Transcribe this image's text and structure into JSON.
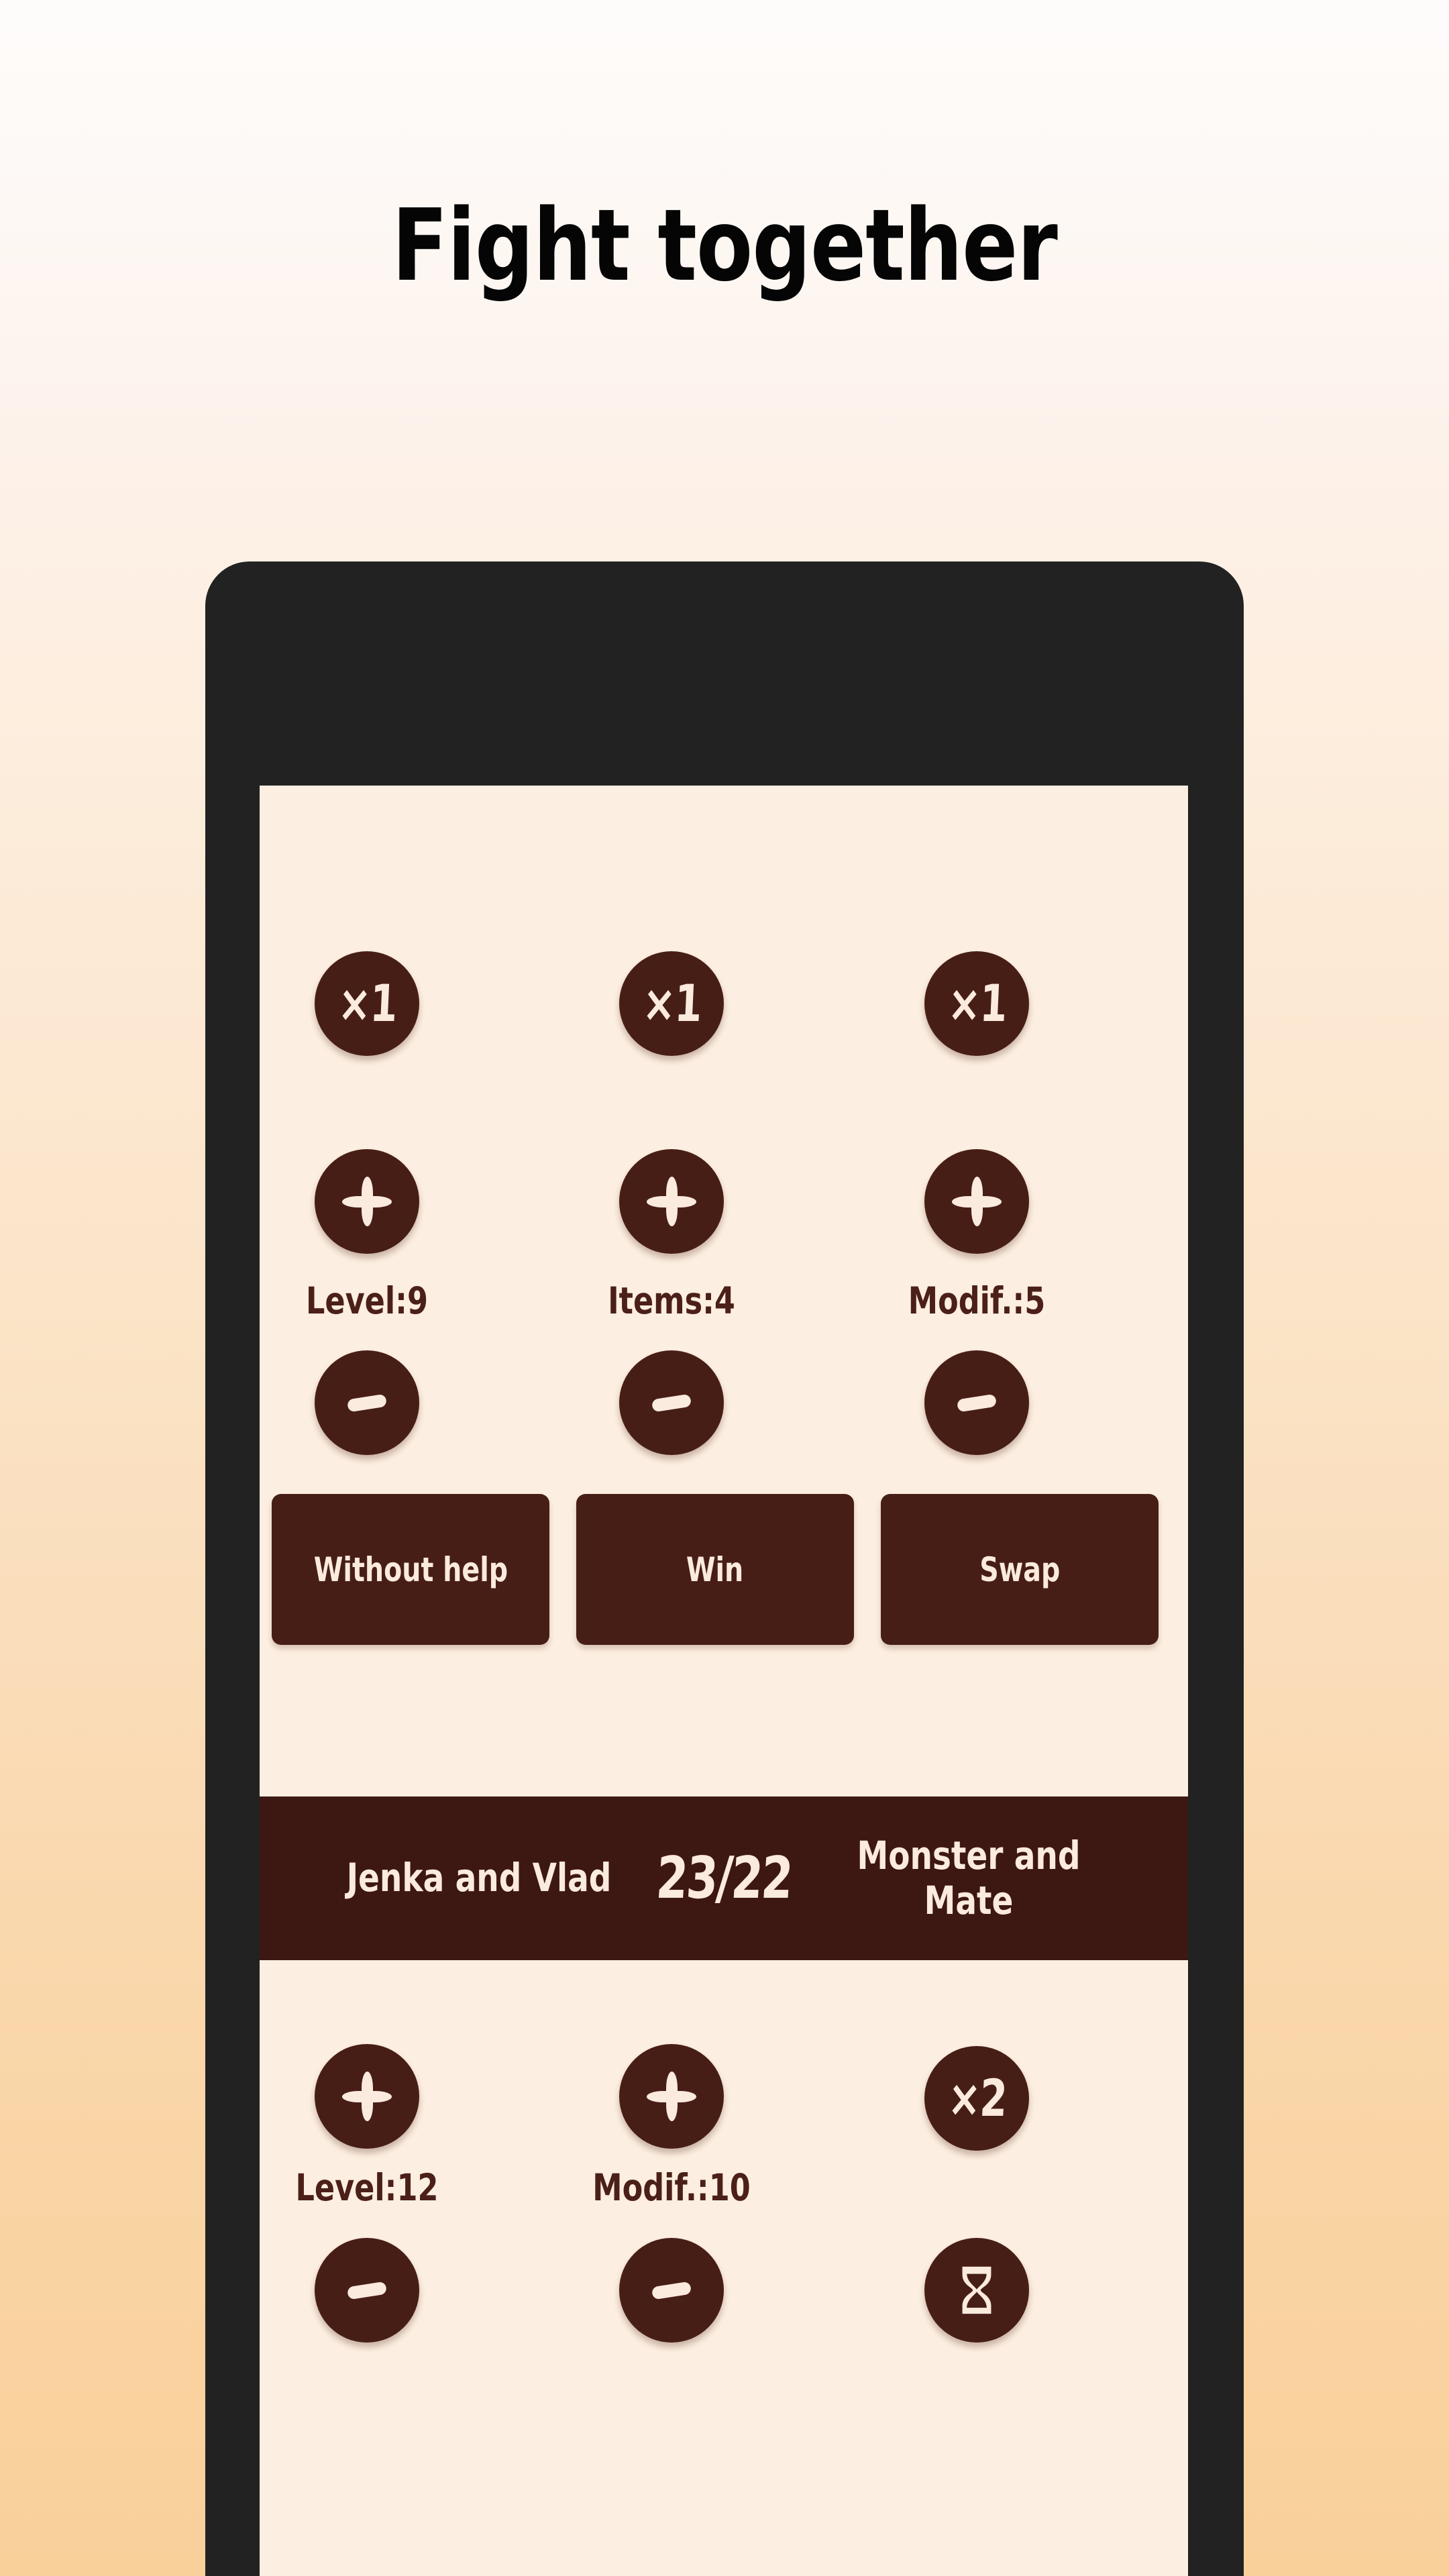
{
  "promo": {
    "title": "Fight together"
  },
  "colors": {
    "background_top": "#fefcfb",
    "background_bottom": "#f9d09a",
    "phone_frame": "#222222",
    "screen_background": "#fceee0",
    "accent_dark": "#471e16",
    "score_bar": "#3d1711",
    "text_light": "#fbeade",
    "text_dark": "#4b2018"
  },
  "screen": {
    "top_panel": {
      "multiplier_row": [
        {
          "id": "level-multiplier",
          "label": "×1",
          "icon": "multiply-icon"
        },
        {
          "id": "items-multiplier",
          "label": "×1",
          "icon": "multiply-icon"
        },
        {
          "id": "modifier-multiplier",
          "label": "×1",
          "icon": "multiply-icon"
        }
      ],
      "increment_row": [
        {
          "id": "level-increment",
          "icon": "plus-icon"
        },
        {
          "id": "items-increment",
          "icon": "plus-icon"
        },
        {
          "id": "modifier-increment",
          "icon": "plus-icon"
        }
      ],
      "stats": [
        {
          "id": "level",
          "label": "Level:9"
        },
        {
          "id": "items",
          "label": "Items:4"
        },
        {
          "id": "modifier",
          "label": "Modif.:5"
        }
      ],
      "decrement_row": [
        {
          "id": "level-decrement",
          "icon": "minus-icon"
        },
        {
          "id": "items-decrement",
          "icon": "minus-icon"
        },
        {
          "id": "modifier-decrement",
          "icon": "minus-icon"
        }
      ],
      "actions": [
        {
          "id": "without-help",
          "label": "Without help"
        },
        {
          "id": "win",
          "label": "Win"
        },
        {
          "id": "swap",
          "label": "Swap"
        }
      ]
    },
    "score_bar": {
      "team_left": "Jenka and Vlad",
      "score": "23/22",
      "team_right": "Monster and Mate"
    },
    "bottom_panel": {
      "top_row": [
        {
          "id": "enemy-level-increment",
          "icon": "plus-icon",
          "label": ""
        },
        {
          "id": "enemy-modifier-increment",
          "icon": "plus-icon",
          "label": ""
        },
        {
          "id": "enemy-multiplier",
          "icon": "multiply-icon",
          "label": "×2"
        }
      ],
      "stats": [
        {
          "id": "enemy-level",
          "label": "Level:12"
        },
        {
          "id": "enemy-modifier",
          "label": "Modif.:10"
        }
      ],
      "bottom_row": [
        {
          "id": "enemy-level-decrement",
          "icon": "minus-icon",
          "label": ""
        },
        {
          "id": "enemy-modifier-decrement",
          "icon": "minus-icon",
          "label": ""
        },
        {
          "id": "enemy-timer",
          "icon": "hourglass-icon",
          "label": ""
        }
      ]
    }
  }
}
